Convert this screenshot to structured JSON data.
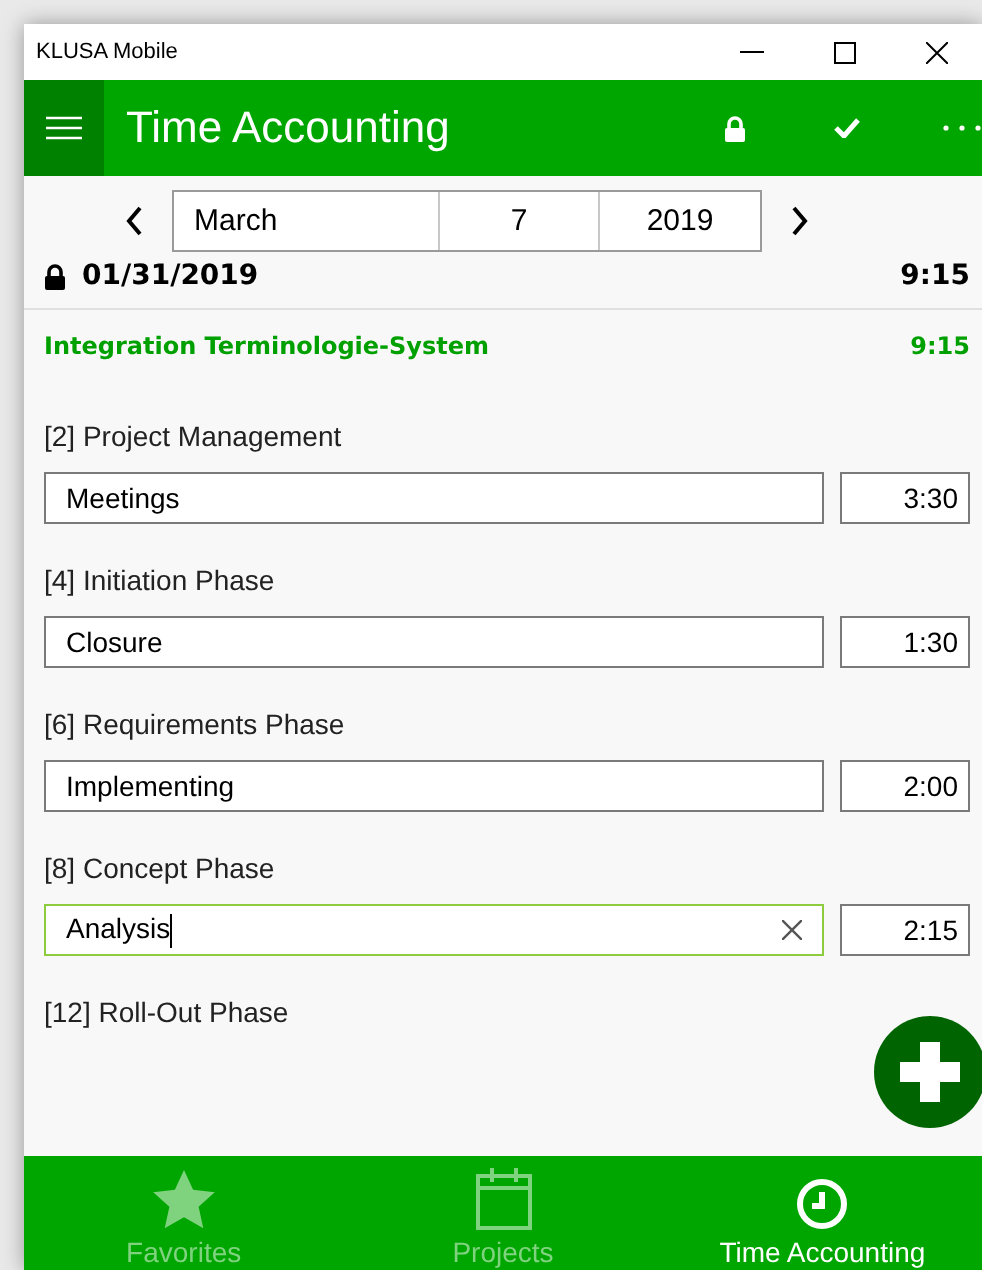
{
  "window": {
    "title": "KLUSA Mobile"
  },
  "header": {
    "title": "Time Accounting"
  },
  "date_picker": {
    "month": "March",
    "day": "7",
    "year": "2019"
  },
  "summary": {
    "date": "01/31/2019",
    "locked": true,
    "total": "9:15"
  },
  "project": {
    "name": "Integration Terminologie-System",
    "total": "9:15"
  },
  "entries": [
    {
      "label": "[2] Project Management",
      "activity": "Meetings",
      "time": "3:30",
      "focused": false
    },
    {
      "label": "[4] Initiation Phase",
      "activity": "Closure",
      "time": "1:30",
      "focused": false
    },
    {
      "label": "[6] Requirements Phase",
      "activity": "Implementing",
      "time": "2:00",
      "focused": false
    },
    {
      "label": "[8] Concept Phase",
      "activity": "Analysis",
      "time": "2:15",
      "focused": true
    },
    {
      "label": "[12] Roll-Out Phase"
    }
  ],
  "tabs": [
    {
      "label": "Favorites",
      "kind": "star",
      "selected": false
    },
    {
      "label": "Projects",
      "kind": "calendar",
      "selected": false
    },
    {
      "label": "Time Accounting",
      "kind": "clock",
      "selected": true
    }
  ]
}
